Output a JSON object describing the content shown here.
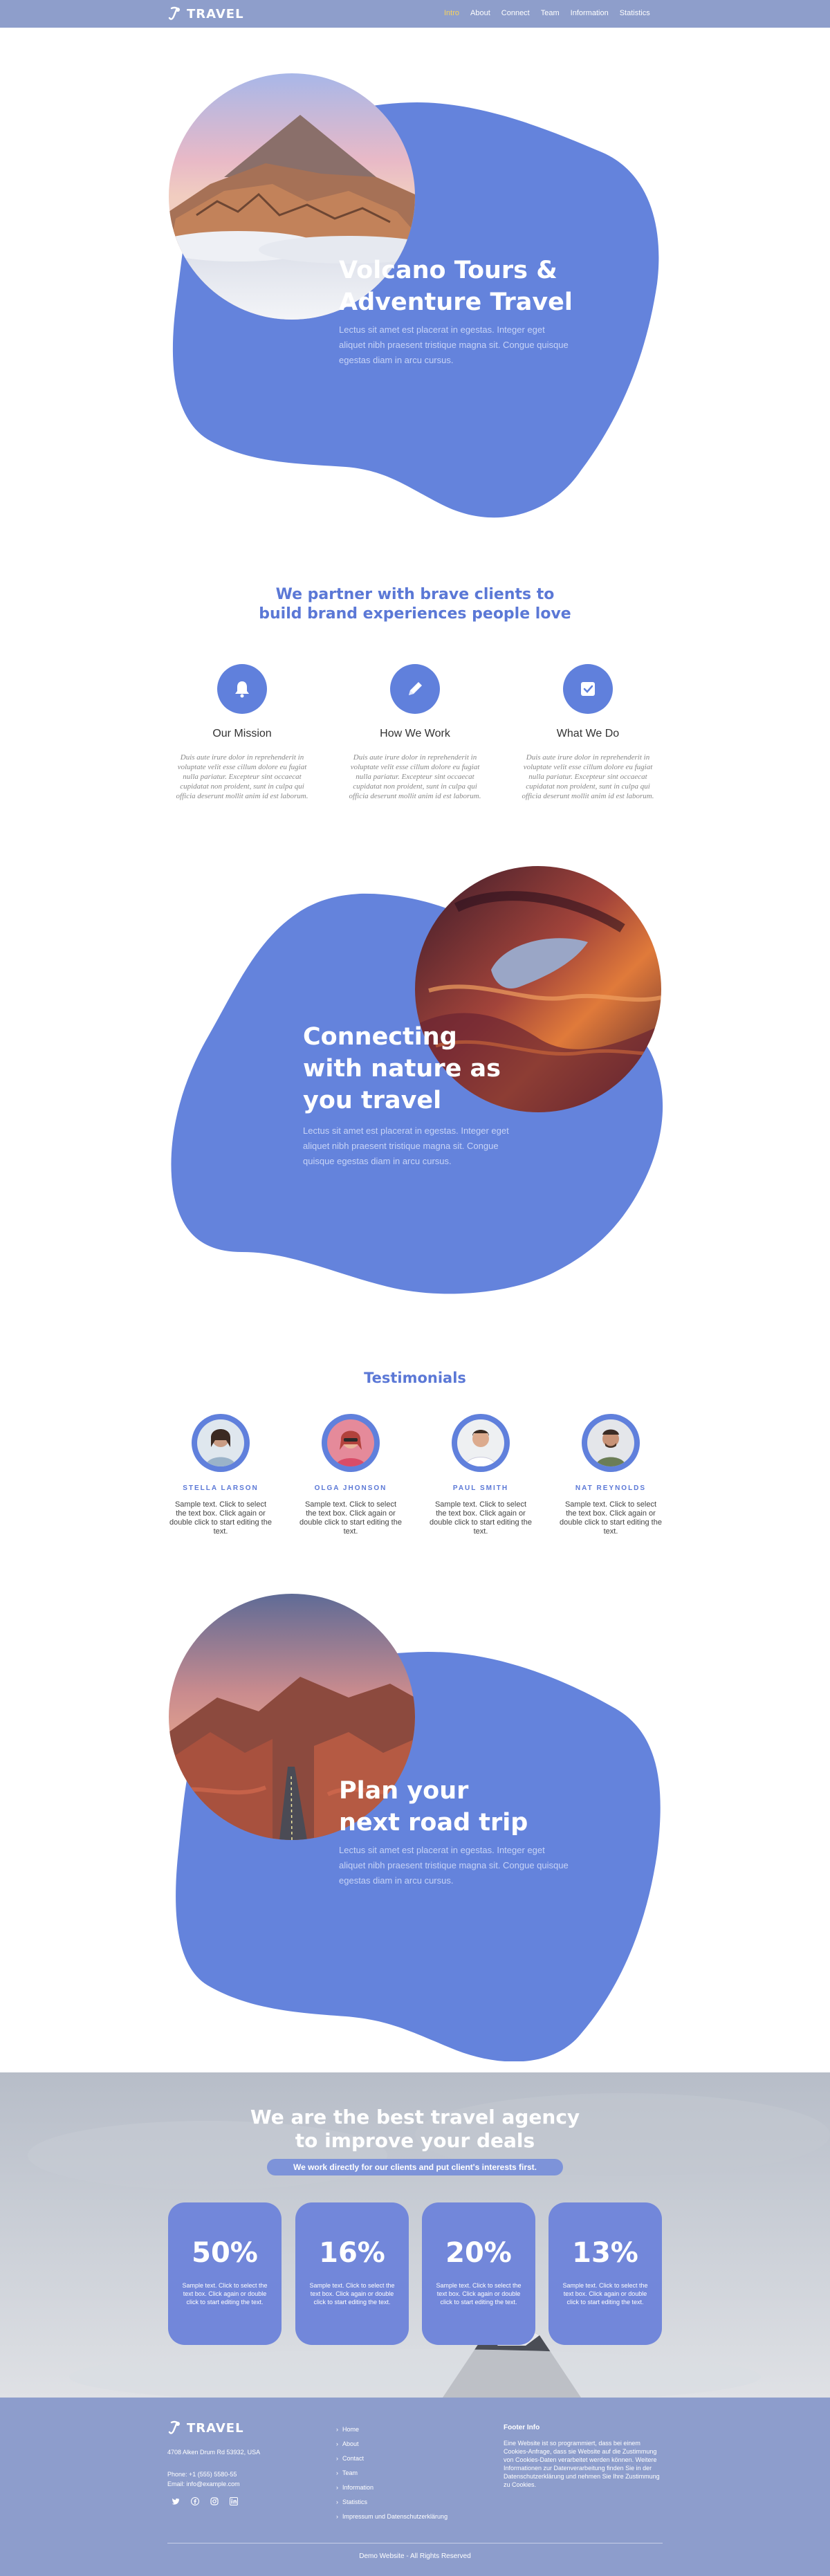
{
  "colors": {
    "accent": "#6483dc",
    "header_bg": "#8e9ecb",
    "nav_active": "#f7d35e",
    "footer_bg": "#8d9dcc"
  },
  "header": {
    "logo": "TRAVEL",
    "nav": [
      "Intro",
      "About",
      "Connect",
      "Team",
      "Information",
      "Statistics"
    ],
    "active": "Intro"
  },
  "hero": {
    "title_line1": "Volcano Tours &",
    "title_line2": "Adventure Travel",
    "text_line1": "Lectus sit amet est placerat in egestas. Integer eget",
    "text_line2": "aliquet nibh praesent tristique magna sit. Congue quisque",
    "text_line3": "egestas diam in arcu cursus."
  },
  "partner": {
    "title_line1": "We partner with brave clients to",
    "title_line2": "build brand experiences people love",
    "features": [
      {
        "icon": "bell-icon",
        "title": "Our Mission",
        "text": "Duis aute irure dolor in reprehenderit in voluptate velit esse cillum dolore eu fugiat nulla pariatur. Excepteur sint occaecat cupidatat non proident, sunt in culpa qui officia deserunt mollit anim id est laborum."
      },
      {
        "icon": "pencil-icon",
        "title": "How We Work",
        "text": "Duis aute irure dolor in reprehenderit in voluptate velit esse cillum dolore eu fugiat nulla pariatur. Excepteur sint occaecat cupidatat non proident, sunt in culpa qui officia deserunt mollit anim id est laborum."
      },
      {
        "icon": "checkbox-icon",
        "title": "What We Do",
        "text": "Duis aute irure dolor in reprehenderit in voluptate velit esse cillum dolore eu fugiat nulla pariatur. Excepteur sint occaecat cupidatat non proident, sunt in culpa qui officia deserunt mollit anim id est laborum."
      }
    ]
  },
  "nature": {
    "title_line1": "Connecting",
    "title_line2": "with nature as",
    "title_line3": "you travel",
    "text_line1": "Lectus sit amet est placerat in egestas. Integer eget",
    "text_line2": "aliquet nibh praesent tristique magna sit. Congue",
    "text_line3": "quisque egestas diam in arcu cursus."
  },
  "testimonials": {
    "title": "Testimonials",
    "items": [
      {
        "name": "STELLA LARSON",
        "text": "Sample text. Click to select the text box. Click again or double click to start editing the text."
      },
      {
        "name": "OLGA JHONSON",
        "text": "Sample text. Click to select the text box. Click again or double click to start editing the text."
      },
      {
        "name": "PAUL SMITH",
        "text": "Sample text. Click to select the text box. Click again or double click to start editing the text."
      },
      {
        "name": "NAT REYNOLDS",
        "text": "Sample text. Click to select the text box. Click again or double click to start editing the text."
      }
    ]
  },
  "roadtrip": {
    "title_line1": "Plan your",
    "title_line2": "next road trip",
    "text_line1": "Lectus sit amet est placerat in egestas. Integer eget",
    "text_line2": "aliquet nibh praesent tristique magna sit. Congue quisque",
    "text_line3": "egestas diam in arcu cursus."
  },
  "stats": {
    "title_line1": "We are the best travel agency",
    "title_line2": "to improve your deals",
    "pill": "We work directly for our clients and put client's interests first.",
    "cards": [
      {
        "value": "50%",
        "text": "Sample text. Click to select the text box. Click again or double click to start editing the text."
      },
      {
        "value": "16%",
        "text": "Sample text. Click to select the text box. Click again or double click to start editing the text."
      },
      {
        "value": "20%",
        "text": "Sample text. Click to select the text box. Click again or double click to start editing the text."
      },
      {
        "value": "13%",
        "text": "Sample text. Click to select the text box. Click again or double click to start editing the text."
      }
    ]
  },
  "footer": {
    "logo": "TRAVEL",
    "address": "4708 Alken Drum Rd 53932, USA",
    "phone": "Phone: +1 (555) 5580-55",
    "email": "Email: info@example.com",
    "links": [
      "Home",
      "About",
      "Contact",
      "Team",
      "Information",
      "Statistics",
      "Impressum und Datenschutzerklärung"
    ],
    "info_title": "Footer Info",
    "info_text": "Eine Website ist so programmiert, dass bei einem Cookies-Anfrage, dass sie Website auf die Zustimmung von Cookies-Daten verarbeitet werden können. Weitere Informationen zur Datenverarbeitung finden Sie in der Datenschutzerklärung und nehmen Sie Ihre Zustimmung zu Cookies.",
    "copyright": "Demo Website - All Rights Reserved"
  }
}
